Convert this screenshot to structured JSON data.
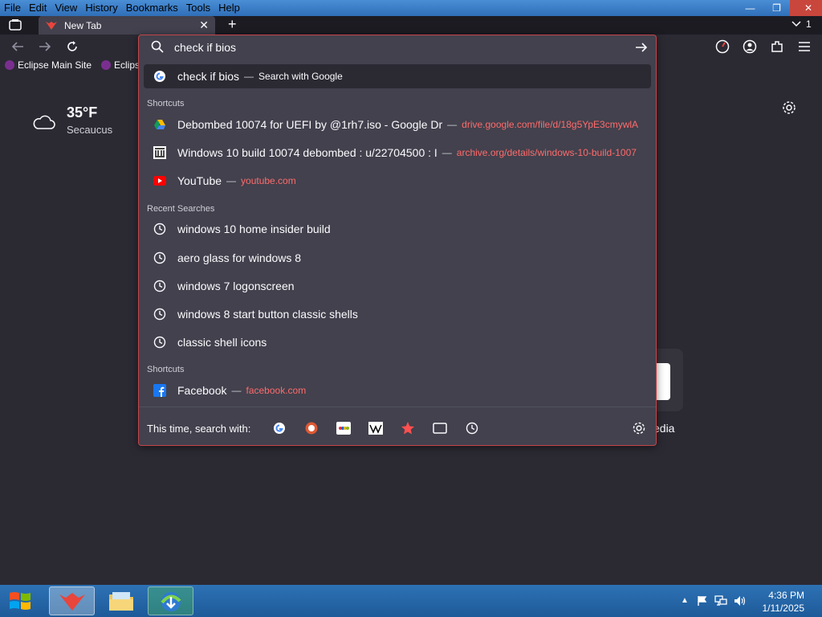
{
  "menubar": {
    "items": [
      {
        "label": "File"
      },
      {
        "label": "Edit"
      },
      {
        "label": "View"
      },
      {
        "label": "History"
      },
      {
        "label": "Bookmarks"
      },
      {
        "label": "Tools"
      },
      {
        "label": "Help"
      }
    ],
    "minimize": "—",
    "restore": "❐",
    "close": "✕"
  },
  "tabstrip": {
    "tab_label": "New Tab",
    "tab_close": "✕",
    "new_tab": "+",
    "tab_count": "1"
  },
  "bookmarks": {
    "items": [
      {
        "label": "Eclipse Main Site"
      },
      {
        "label": "Eclips"
      }
    ]
  },
  "weather": {
    "temp": "35°F",
    "city": "Secaucus"
  },
  "tiles": {
    "media_label": "edia"
  },
  "urlbar": {
    "value": "check if bios",
    "go_icon": "arrow-right-icon",
    "top_suggestion": {
      "text": "check if bios",
      "sep": "—",
      "action": "Search with Google"
    },
    "shortcuts_heading_1": "Shortcuts",
    "shortcuts_1": [
      {
        "title": "Debombed 10074 for UEFI by @1rh7.iso - Google Dr",
        "sep": "—",
        "url": "drive.google.com/file/d/18g5YpE3cmywlA"
      },
      {
        "title": "Windows 10 build 10074 debombed : u/22704500 : I",
        "sep": "—",
        "url": "archive.org/details/windows-10-build-1007"
      },
      {
        "title": "YouTube",
        "sep": "—",
        "url": "youtube.com"
      }
    ],
    "recent_heading": "Recent Searches",
    "recent": [
      {
        "text": "windows 10 home insider build"
      },
      {
        "text": "aero glass for windows 8"
      },
      {
        "text": "windows 7 logonscreen"
      },
      {
        "text": "windows 8 start button classic shells"
      },
      {
        "text": "classic shell icons"
      }
    ],
    "shortcuts_heading_2": "Shortcuts",
    "shortcuts_2": [
      {
        "title": "Facebook",
        "sep": "—",
        "url": "facebook.com"
      }
    ],
    "oneoff_label": "This time, search with:"
  },
  "taskbar": {
    "time": "4:36 PM",
    "date": "1/11/2025"
  },
  "colors": {
    "accent": "#c4454a",
    "url": "#ff6b6b",
    "panel": "#42414d",
    "bg": "#2b2a33"
  }
}
